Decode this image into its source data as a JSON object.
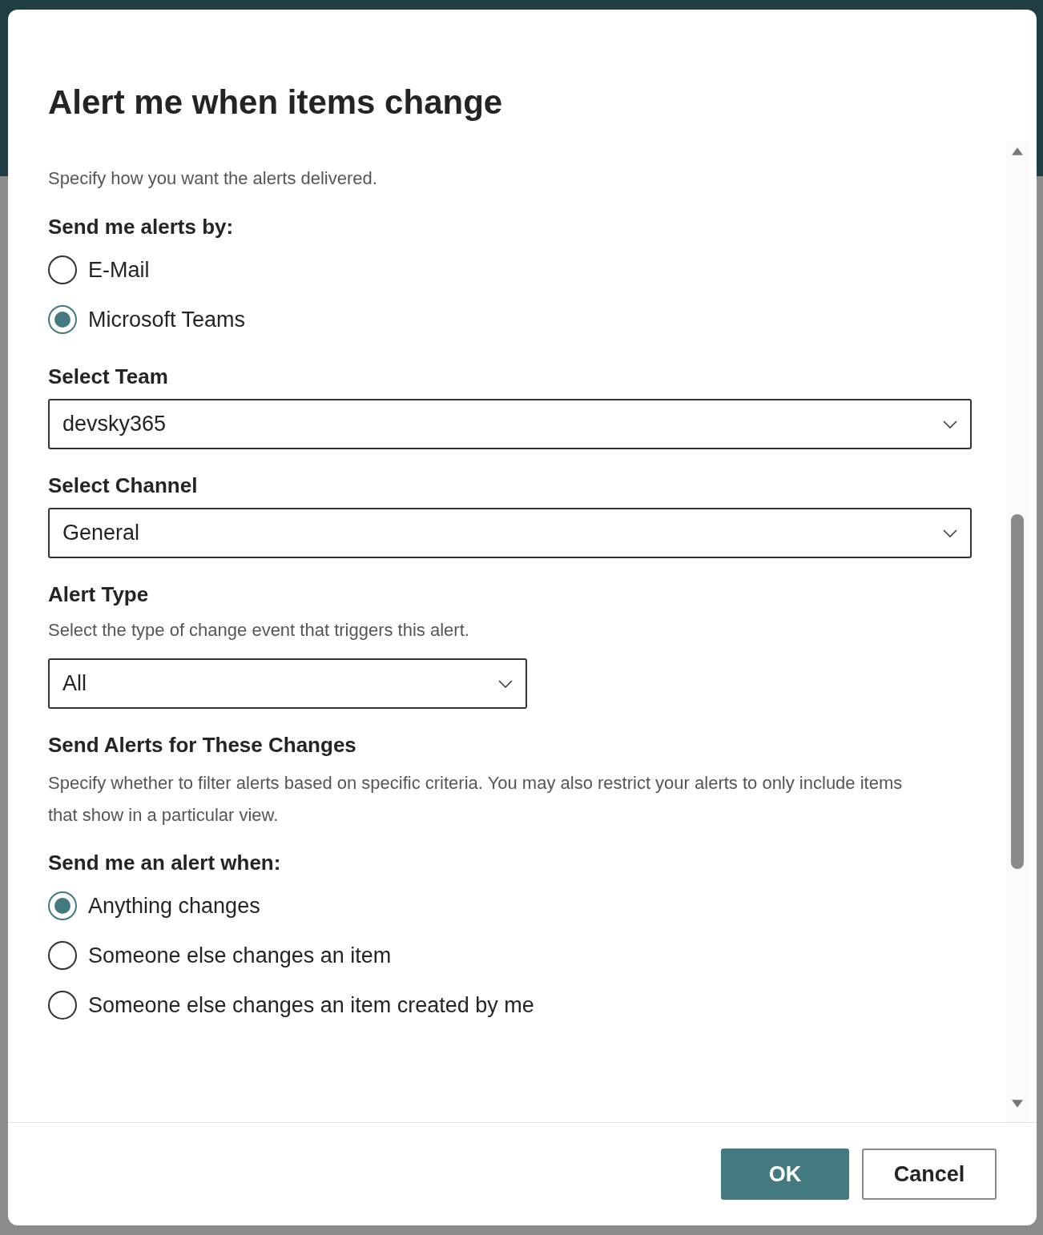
{
  "title": "Alert me when items change",
  "intro": "Specify how you want the alerts delivered.",
  "delivery": {
    "label": "Send me alerts by:",
    "options": [
      {
        "label": "E-Mail",
        "selected": false
      },
      {
        "label": "Microsoft Teams",
        "selected": true
      }
    ]
  },
  "team": {
    "label": "Select Team",
    "value": "devsky365"
  },
  "channel": {
    "label": "Select Channel",
    "value": "General"
  },
  "alert_type": {
    "label": "Alert Type",
    "description": "Select the type of change event that triggers this alert.",
    "value": "All"
  },
  "changes": {
    "heading": "Send Alerts for These Changes",
    "description": "Specify whether to filter alerts based on specific criteria. You may also restrict your alerts to only include items that show in a particular view.",
    "label": "Send me an alert when:",
    "options": [
      {
        "label": "Anything changes",
        "selected": true
      },
      {
        "label": "Someone else changes an item",
        "selected": false
      },
      {
        "label": "Someone else changes an item created by me",
        "selected": false
      }
    ]
  },
  "buttons": [
    {
      "label": "OK",
      "kind": "primary"
    },
    {
      "label": "Cancel",
      "kind": "secondary"
    }
  ]
}
